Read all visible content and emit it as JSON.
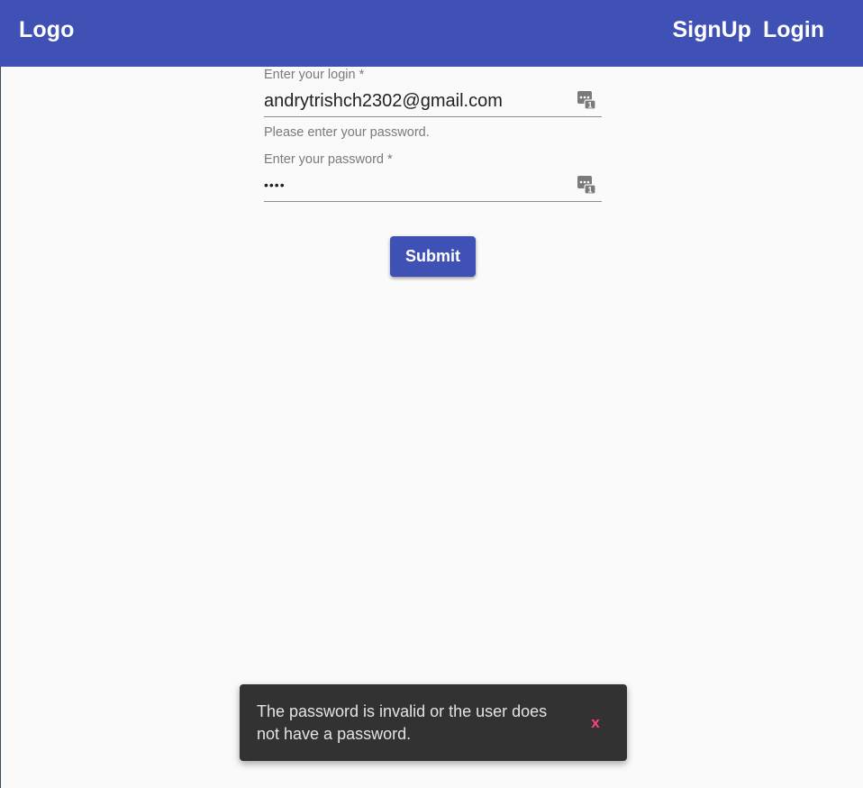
{
  "header": {
    "logo": "Logo",
    "nav": {
      "signup": "SignUp",
      "login": "Login"
    },
    "color": "#3f51b5"
  },
  "form": {
    "login_field": {
      "label": "Enter your login *",
      "value": "andrytrishch2302@gmail.com",
      "icon": "password-manager-key-icon"
    },
    "password_hint": "Please enter your password.",
    "password_field": {
      "label": "Enter your password *",
      "value": "••••",
      "icon": "password-manager-key-icon"
    },
    "submit_label": "Submit"
  },
  "snackbar": {
    "message": "The password is invalid or the user does not have a password.",
    "close_label": "x",
    "action_color": "#ff4081"
  }
}
